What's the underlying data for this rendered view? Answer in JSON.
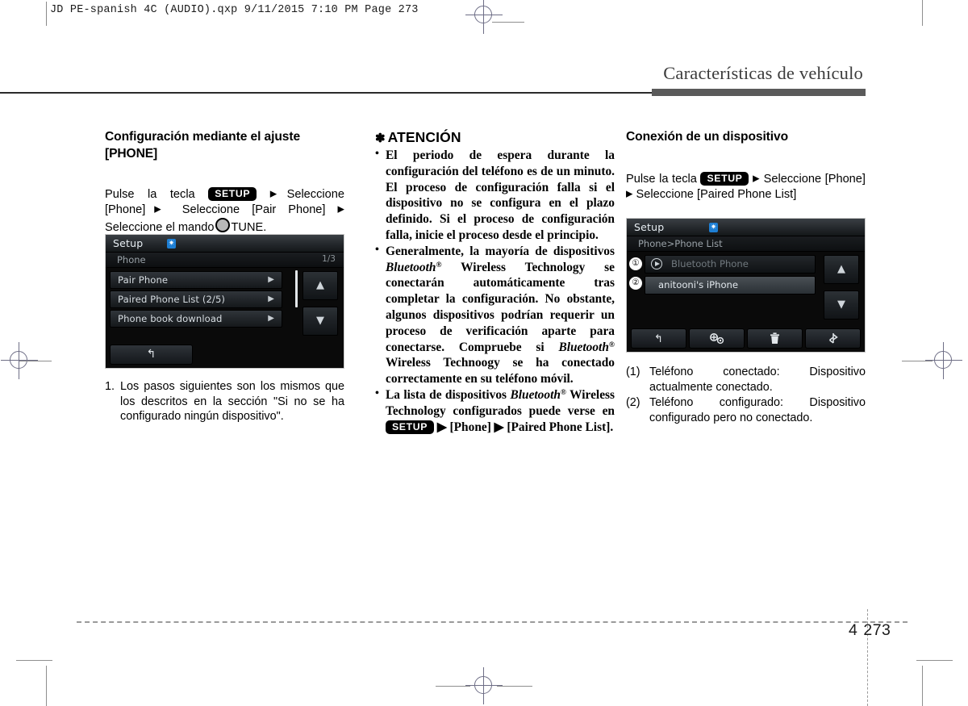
{
  "print_header": {
    "text": "JD PE-spanish 4C (AUDIO).qxp   9/11/2015   7:10 PM   Page 273"
  },
  "running_head": {
    "title": "Características de vehículo"
  },
  "left_column": {
    "heading": "Configuración mediante el ajuste [PHONE]",
    "instruction": {
      "prefix": "Pulse la tecla",
      "key_1": "SETUP",
      "mid_1": "Seleccione [Phone]",
      "mid_2": "Seleccione [Pair Phone]",
      "tail": "Seleccione el mando",
      "tune": "TUNE."
    },
    "note": {
      "number": "1.",
      "text": "Los pasos siguientes son los mismos que los descritos en la sección \"Si no se ha configurado ningún dispositivo\"."
    },
    "screenshot": {
      "title": "Setup",
      "bt_icon": "bluetooth-icon",
      "subtitle": "Phone",
      "page_index": "1/3",
      "rows": [
        {
          "label": "Pair Phone"
        },
        {
          "label": "Paired Phone List  (2/5)"
        },
        {
          "label": "Phone book download"
        }
      ],
      "scroll_up": "scroll-up-icon",
      "scroll_down": "scroll-down-icon",
      "back_button": "back-icon"
    }
  },
  "middle_column": {
    "attention_title": "ATENCIÓN",
    "attention_star": "✽",
    "bullets": [
      {
        "segments": [
          {
            "t": "plain",
            "v": "El periodo de espera durante la configuración del teléfono es de un minuto. El proceso de configuración falla si el dispositivo no se configura en el plazo definido. Si el proceso de configuración falla, inicie el proceso desde el principio."
          }
        ]
      },
      {
        "segments": [
          {
            "t": "plain",
            "v": "Generalmente, la mayoría de dispositivos "
          },
          {
            "t": "bluetooth",
            "v": "Bluetooth"
          },
          {
            "t": "plain",
            "v": " Wireless Technology se conectarán automáticamente tras completar la configuración. No obstante, algunos dispositivos podrían requerir un proceso de verificación aparte para conectarse. Compruebe si "
          },
          {
            "t": "bluetooth",
            "v": "Bluetooth"
          },
          {
            "t": "plain",
            "v": " Wireless Technoogy se ha conectado correctamente en su teléfono móvil."
          }
        ]
      },
      {
        "segments": [
          {
            "t": "plain",
            "v": "La lista de dispositivos "
          },
          {
            "t": "bluetooth",
            "v": "Bluetooth"
          },
          {
            "t": "plain",
            "v": " Wireless Technology configurados puede verse en "
          },
          {
            "t": "key",
            "v": "SETUP"
          },
          {
            "t": "plain",
            "v": " ▶ [Phone] ▶ [Paired Phone List]."
          }
        ]
      }
    ]
  },
  "right_column": {
    "heading": "Conexión de un dispositivo",
    "instruction": {
      "prefix": "Pulse la tecla",
      "key_1": "SETUP",
      "mid_1": "Seleccione [Phone]",
      "mid_2": "Seleccione [Paired Phone List]"
    },
    "screenshot": {
      "title": "Setup",
      "bt_icon": "bluetooth-icon",
      "subtitle": "Phone>Phone List",
      "rows": [
        {
          "label": "Bluetooth Phone",
          "state": "connected",
          "callout": "①"
        },
        {
          "label": "anitooni's iPhone",
          "state": "paired",
          "callout": "②"
        }
      ],
      "scroll_up": "scroll-up-icon",
      "scroll_down": "scroll-down-icon",
      "bottom_buttons": [
        {
          "name": "back-icon"
        },
        {
          "name": "add-device-icon"
        },
        {
          "name": "delete-icon"
        },
        {
          "name": "connect-icon"
        }
      ]
    },
    "legend": [
      {
        "num": "(1)",
        "text": "Teléfono conectado: Dispositivo actualmente conectado."
      },
      {
        "num": "(2)",
        "text": "Teléfono configurado: Dispositivo configurado pero no conectado."
      }
    ]
  },
  "footer": {
    "chapter": "4",
    "page": "273"
  }
}
